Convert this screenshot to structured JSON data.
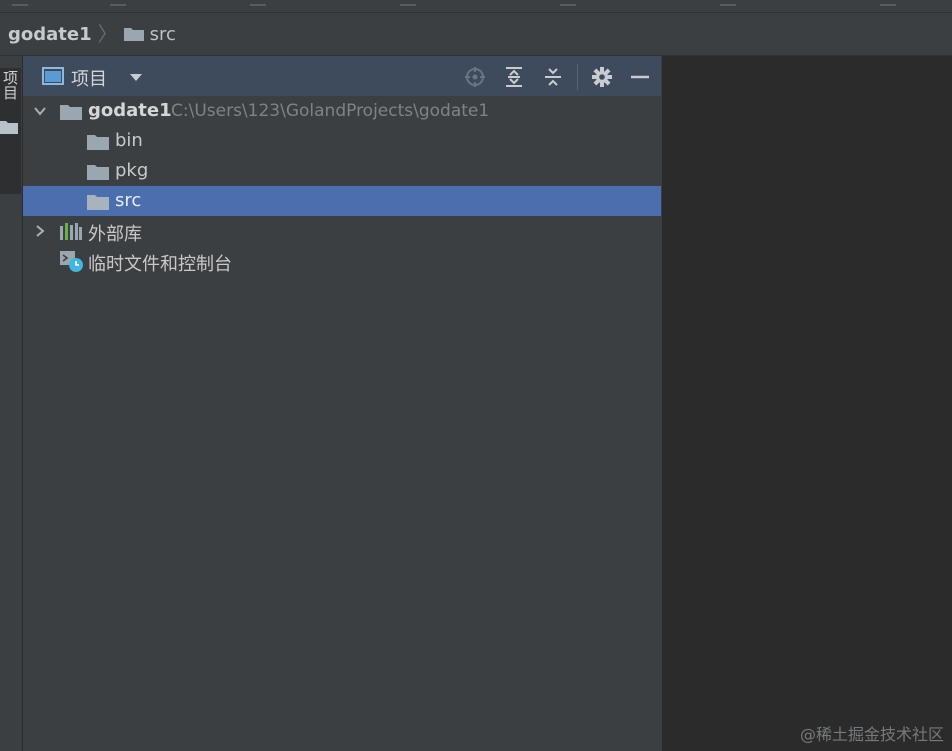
{
  "navbar": {
    "project_name": "godate1",
    "current_folder": "src"
  },
  "side_strip": {
    "project_tab_label": "项目"
  },
  "project_panel": {
    "title": "项目",
    "toolbar": {
      "locate": "crosshair-icon",
      "expand_all": "expand-all-icon",
      "collapse_all": "collapse-all-icon",
      "settings": "gear-icon",
      "hide": "minimize-icon"
    },
    "tree": {
      "root": {
        "label": "godate1",
        "path": "C:\\Users\\123\\GolandProjects\\godate1"
      },
      "children": [
        {
          "label": "bin"
        },
        {
          "label": "pkg"
        },
        {
          "label": "src",
          "selected": true
        }
      ],
      "external_libraries": "外部库",
      "scratches": "临时文件和控制台"
    }
  },
  "colors": {
    "panel_bg": "#3c3f41",
    "header_bg": "#3d4b5c",
    "selection": "#4b6eaf",
    "editor_bg": "#2b2b2b",
    "folder": "#9aa7b0"
  },
  "watermark": "@稀土掘金技术社区"
}
